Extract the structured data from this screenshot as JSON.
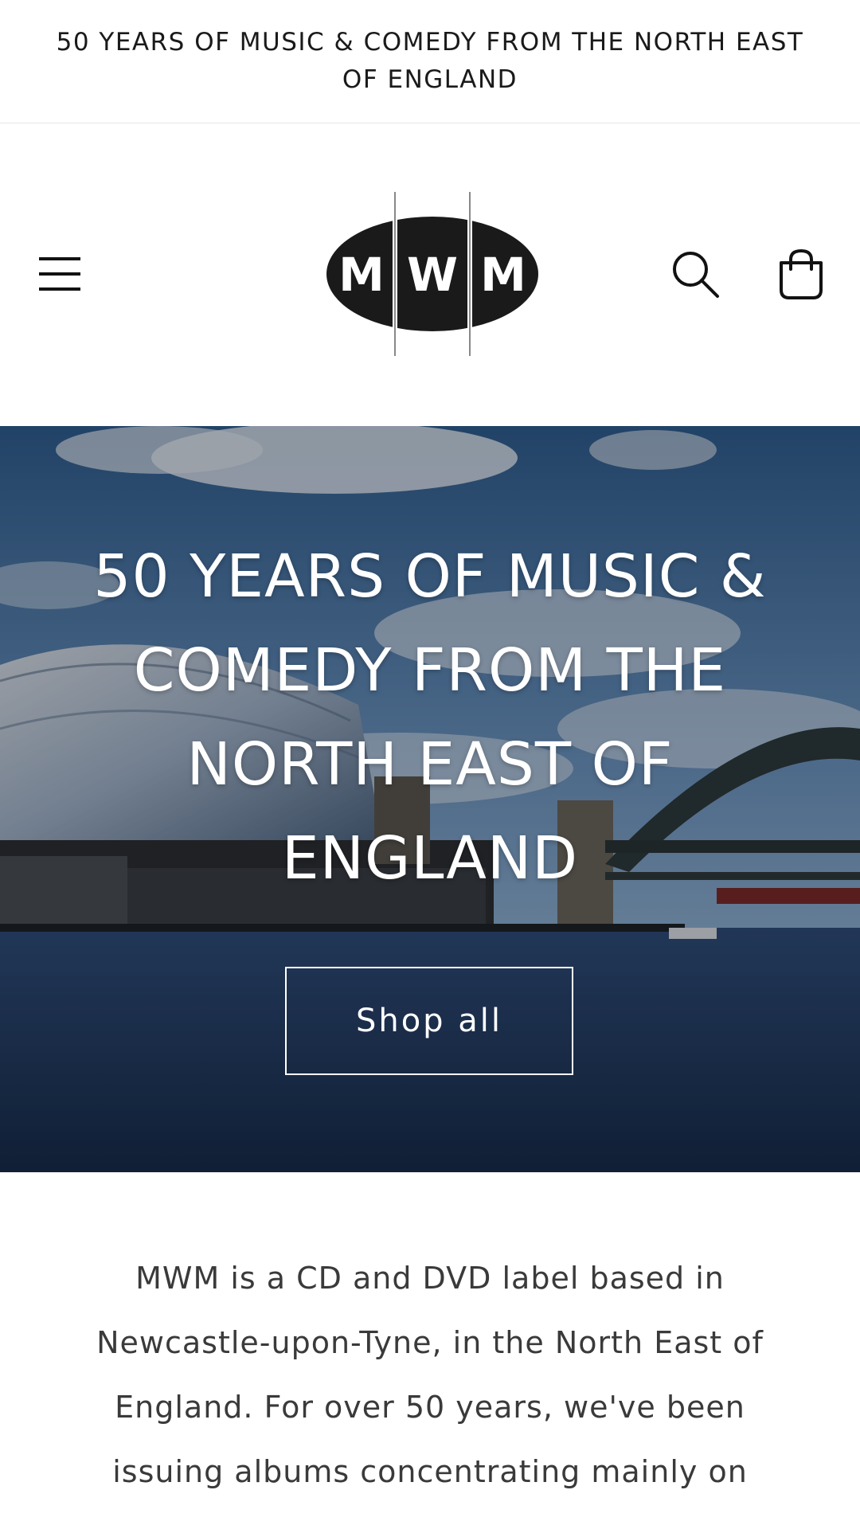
{
  "announcement": {
    "text": "50 YEARS OF MUSIC & COMEDY FROM THE NORTH EAST OF ENGLAND"
  },
  "header": {
    "logo_letters": [
      "M",
      "W",
      "M"
    ],
    "icons": {
      "menu": "menu-icon",
      "search": "search-icon",
      "cart": "cart-icon"
    }
  },
  "hero": {
    "title": "50 YEARS OF MUSIC & COMEDY FROM THE NORTH EAST OF ENGLAND",
    "button_label": "Shop all"
  },
  "intro": {
    "text": "MWM is a CD and DVD label based in Newcastle-upon-Tyne, in the North East of England. For over 50 years, we've been issuing albums concentrating mainly on"
  },
  "colors": {
    "text": "#121212",
    "background": "#ffffff",
    "overlay_text": "#ffffff",
    "body_text": "#3a3a3a"
  }
}
